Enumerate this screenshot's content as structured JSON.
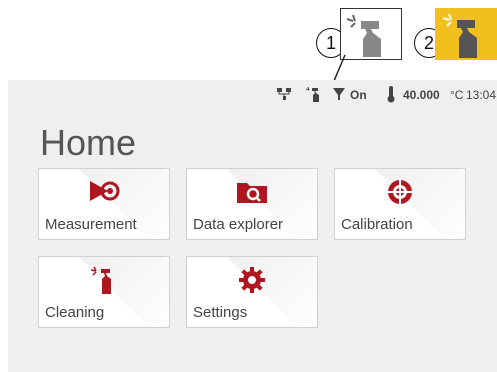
{
  "callouts": [
    "1",
    "2"
  ],
  "status": {
    "pump_label": "On",
    "temperature": "40.000",
    "temp_unit": "°C",
    "time": "13:04"
  },
  "page_title": "Home",
  "tiles": [
    {
      "label": "Measurement",
      "icon": "measurement-icon"
    },
    {
      "label": "Data explorer",
      "icon": "folder-search-icon"
    },
    {
      "label": "Calibration",
      "icon": "target-icon"
    },
    {
      "label": "Cleaning",
      "icon": "spray-bottle-icon"
    },
    {
      "label": "Settings",
      "icon": "gear-icon"
    }
  ],
  "colors": {
    "accent": "#b0161f",
    "highlight": "#f2c01e"
  }
}
